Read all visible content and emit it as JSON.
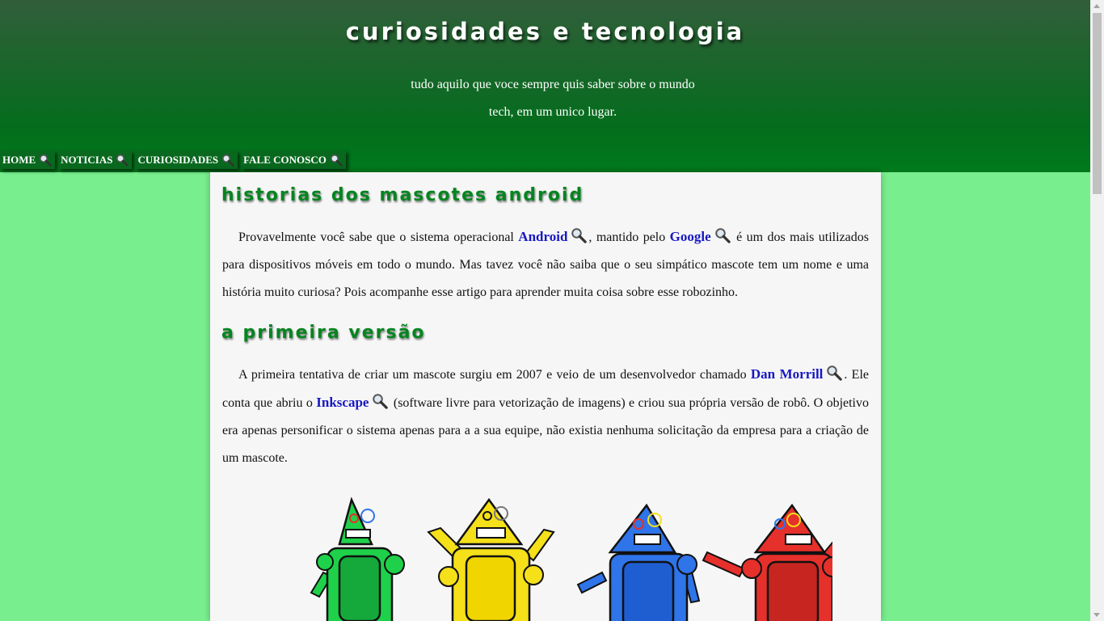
{
  "header": {
    "title": "Curiosidades e Tecnologia",
    "tagline_line1": "tudo aquilo que voce sempre quis saber sobre o mundo",
    "tagline_line2": "tech, em um unico lugar."
  },
  "nav": {
    "items": [
      {
        "label": "HOME",
        "icon": "magnifier-icon"
      },
      {
        "label": "NOTICIAS",
        "icon": "magnifier-icon"
      },
      {
        "label": "CURIOSIDADES",
        "icon": "magnifier-icon"
      },
      {
        "label": "FALE CONOSCO",
        "icon": "magnifier-icon"
      }
    ]
  },
  "article": {
    "section1_title": "Historias dos Mascotes Android",
    "p1": {
      "t1": "Provavelmente você sabe que o sistema operacional ",
      "link1": "Android",
      "t2": ", mantido pelo ",
      "link2": "Google",
      "t3": " é um dos mais utilizados para dispositivos móveis em todo o mundo. Mas tavez você não saiba que o seu simpático mascote tem um nome e uma história muito curiosa? Pois acompanhe esse artigo para aprender muita coisa sobre esse robozinho."
    },
    "section2_title": "A Primeira Versão",
    "p2": {
      "t1": "A primeira tentativa de criar um mascote surgiu em 2007 e veio de um desenvolvedor chamado ",
      "link1": "Dan Morrill",
      "t2": ". Ele conta que abriu o ",
      "link2": "Inkscape",
      "t3": " (software livre para vetorização de imagens) e criou sua própria versão de robô. O objetivo era apenas personificar o sistema apenas para a a sua equipe, não existia nenhuma solicitação da empresa para a criação de um mascote."
    }
  },
  "colors": {
    "page_bg": "#79ee8f",
    "header_top": "#325e3a",
    "header_bottom": "#007a1c",
    "heading_green": "#04851f",
    "link_blue": "#1717c4",
    "robots": [
      "#1fd14a",
      "#f5e01a",
      "#2f74e8",
      "#e6302b"
    ]
  }
}
